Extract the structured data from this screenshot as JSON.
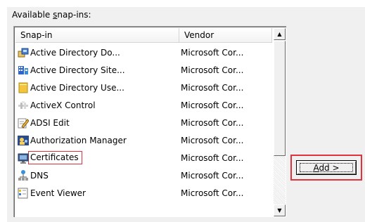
{
  "caption": {
    "pre": "Available ",
    "underline": "s",
    "post": "nap-ins:"
  },
  "columns": [
    "Snap-in",
    "Vendor"
  ],
  "snapins": [
    {
      "name": "Active Directory Do...",
      "vendor": "Microsoft Cor...",
      "icon": "ad-domains-icon"
    },
    {
      "name": "Active Directory Site...",
      "vendor": "Microsoft Cor...",
      "icon": "ad-sites-icon"
    },
    {
      "name": "Active Directory Use...",
      "vendor": "Microsoft Cor...",
      "icon": "ad-users-icon"
    },
    {
      "name": "ActiveX Control",
      "vendor": "Microsoft Cor...",
      "icon": "activex-icon"
    },
    {
      "name": "ADSI Edit",
      "vendor": "Microsoft Cor...",
      "icon": "adsi-edit-icon"
    },
    {
      "name": "Authorization Manager",
      "vendor": "Microsoft Cor...",
      "icon": "authorization-manager-icon"
    },
    {
      "name": "Certificates",
      "vendor": "Microsoft Cor...",
      "icon": "certificates-icon",
      "highlighted": true
    },
    {
      "name": "DNS",
      "vendor": "Microsoft Cor...",
      "icon": "dns-icon"
    },
    {
      "name": "Event Viewer",
      "vendor": "Microsoft Cor...",
      "icon": "event-viewer-icon"
    }
  ],
  "add_button": {
    "pre": "",
    "underline": "A",
    "post": "dd >"
  },
  "colors": {
    "highlight_border": "#e0323c",
    "panel": "#f0f0f0"
  }
}
